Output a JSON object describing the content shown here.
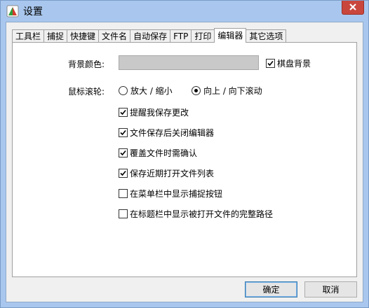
{
  "window": {
    "title": "设置"
  },
  "tabs": [
    {
      "label": "工具栏",
      "active": false
    },
    {
      "label": "捕捉",
      "active": false
    },
    {
      "label": "快捷键",
      "active": false
    },
    {
      "label": "文件名",
      "active": false
    },
    {
      "label": "自动保存",
      "active": false
    },
    {
      "label": "FTP",
      "active": false
    },
    {
      "label": "打印",
      "active": false
    },
    {
      "label": "编辑器",
      "active": true
    },
    {
      "label": "其它选项",
      "active": false
    }
  ],
  "editor": {
    "background_color_label": "背景颜色:",
    "background_color_value": "#c9c9c9",
    "checkerboard_label": "棋盘背景",
    "checkerboard_checked": true,
    "mouse_wheel_label": "鼠标滚轮:",
    "wheel_zoom_label": "放大 / 缩小",
    "wheel_zoom_selected": false,
    "wheel_scroll_label": "向上 / 向下滚动",
    "wheel_scroll_selected": true,
    "options": [
      {
        "label": "提醒我保存更改",
        "checked": true
      },
      {
        "label": "文件保存后关闭编辑器",
        "checked": true
      },
      {
        "label": "覆盖文件时需确认",
        "checked": true
      },
      {
        "label": "保存近期打开文件列表",
        "checked": true
      },
      {
        "label": "在菜单栏中显示捕捉按钮",
        "checked": false
      },
      {
        "label": "在标题栏中显示被打开文件的完整路径",
        "checked": false
      }
    ]
  },
  "buttons": {
    "ok": "确定",
    "cancel": "取消"
  },
  "icons": {
    "app": "app-logo-icon",
    "close": "close-icon",
    "check": "checkmark-icon"
  }
}
